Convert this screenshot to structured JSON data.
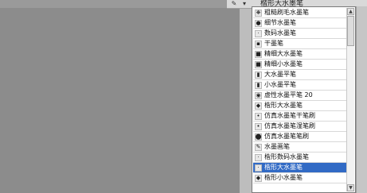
{
  "topbar": {
    "label": "楷形大水墨笔",
    "icons": [
      "brush-tool-icon",
      "dropdown-arrow-icon"
    ]
  },
  "brush_list": {
    "items": [
      {
        "label": "粗糙刷毛水墨笔",
        "icon": "brush-bristle-icon"
      },
      {
        "label": "细节水墨笔",
        "icon": "round-brush-icon"
      },
      {
        "label": "数码水墨笔",
        "icon": "dot-brush-icon"
      },
      {
        "label": "干墨笔",
        "icon": "dry-brush-icon"
      },
      {
        "label": "精细大水墨笔",
        "icon": "square-brush-icon"
      },
      {
        "label": "精细小水墨笔",
        "icon": "square-brush-icon"
      },
      {
        "label": "大水墨平笔",
        "icon": "flat-brush-icon"
      },
      {
        "label": "小水墨平笔",
        "icon": "flat-brush-icon"
      },
      {
        "label": "虚性水墨平笔 20",
        "icon": "soft-round-brush-icon"
      },
      {
        "label": "楷形大水墨笔",
        "icon": "calligraphy-brush-icon"
      },
      {
        "label": "仿真水墨笔干笔刷",
        "icon": "dotted-brush-icon"
      },
      {
        "label": "仿真水墨笔湿笔刷",
        "icon": "dotted-brush-icon"
      },
      {
        "label": "仿真水墨笔笔刷",
        "icon": "blob-brush-icon"
      },
      {
        "label": "水墨画笔",
        "icon": "pen-brush-icon"
      },
      {
        "label": "楷形数码水墨笔",
        "icon": "dot-brush-icon"
      },
      {
        "label": "楷形大水墨笔",
        "icon": "dot-brush-icon",
        "selected": true
      },
      {
        "label": "楷形小水墨笔",
        "icon": "calligraphy-brush-icon"
      }
    ]
  },
  "colors": {
    "canvas": "#8c8c8c",
    "selected": "#316ac5",
    "panel": "#ffffff"
  }
}
